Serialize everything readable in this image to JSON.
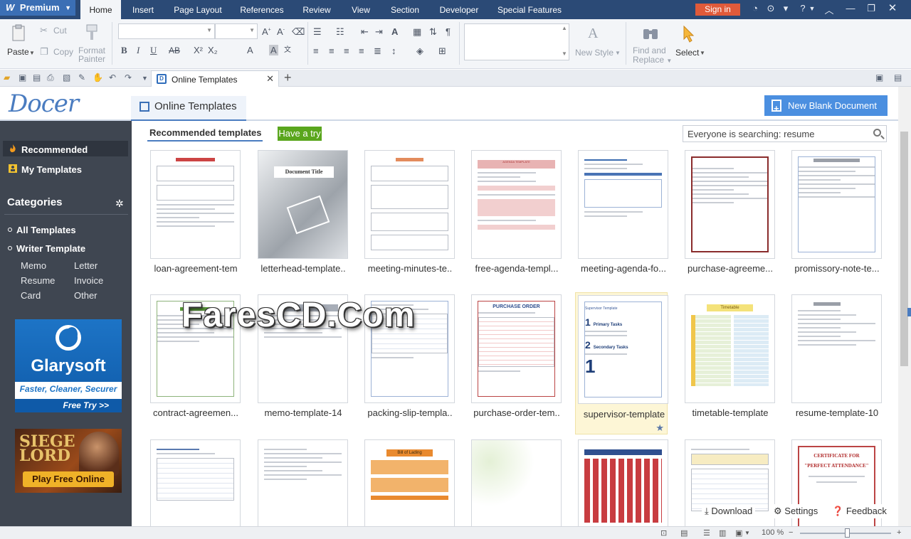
{
  "app": {
    "edition_label": "Premium"
  },
  "menu": {
    "tabs": [
      "Home",
      "Insert",
      "Page Layout",
      "References",
      "Review",
      "View",
      "Section",
      "Developer",
      "Special Features"
    ],
    "active": "Home",
    "signin_label": "Sign in"
  },
  "ribbon": {
    "paste": "Paste",
    "cut": "Cut",
    "copy": "Copy",
    "format_painter_1": "Format",
    "format_painter_2": "Painter",
    "font_bold": "B",
    "font_italic": "I",
    "font_underline": "U",
    "new_style": "New Style",
    "find_replace_1": "Find and",
    "find_replace_2": "Replace",
    "select": "Select"
  },
  "document_tab": {
    "title": "Online Templates",
    "icon_letter": "D"
  },
  "docer": {
    "logo_text": "Docer",
    "header_tab": "Online Templates",
    "new_blank_label": "New Blank Document"
  },
  "sidebar": {
    "recommended": "Recommended",
    "my_templates": "My Templates",
    "categories_title": "Categories",
    "categories": [
      "All Templates",
      "Writer Template"
    ],
    "subcategories": [
      "Memo",
      "Letter",
      "Resume",
      "Invoice",
      "Card",
      "Other"
    ],
    "ad1": {
      "name": "Glarysoft",
      "tagline": "Faster, Cleaner, Securer",
      "cta": "Free Try >>"
    },
    "ad2": {
      "logo_line1": "SIEGE",
      "logo_line2": "LORD",
      "cta": "Play Free Online"
    }
  },
  "content": {
    "section_title": "Recommended templates",
    "have_a_try": "Have a try",
    "search_placeholder": "Everyone is searching: resume",
    "templates_row1": [
      "loan-agreement-tem",
      "letterhead-template..",
      "meeting-minutes-te..",
      "free-agenda-templ...",
      "meeting-agenda-fo...",
      "purchase-agreeme...",
      "promissory-note-te..."
    ],
    "templates_row2": [
      "contract-agreemen...",
      "memo-template-14",
      "packing-slip-templa..",
      "purchase-order-tem..",
      "supervisor-template",
      "timetable-template",
      "resume-template-10"
    ],
    "thumb_text": {
      "letterhead": "Document Title",
      "supervisor": "Supervisor Template",
      "supervisor_tasks1": "Primary Tasks",
      "supervisor_tasks2": "Secondary Tasks",
      "purchase_order": "PURCHASE ORDER",
      "certificate_1": "CERTIFICATE FOR",
      "certificate_2": "\"PERFECT ATTENDANCE\"",
      "timetable": "Timetable",
      "bill_of_lading": "Bill of Lading",
      "agenda": "AGENDA TEMPLATE"
    },
    "bottom_tools": {
      "download": "Download",
      "settings": "Settings",
      "feedback": "Feedback"
    }
  },
  "watermark": "FaresCD.Com",
  "status": {
    "zoom": "100 %"
  },
  "colors": {
    "menu_bar": "#2b4a76",
    "accent_blue": "#4a7cc0",
    "signin": "#e05a3a",
    "have_try": "#5aa61d",
    "sidebar": "#3f4651"
  }
}
